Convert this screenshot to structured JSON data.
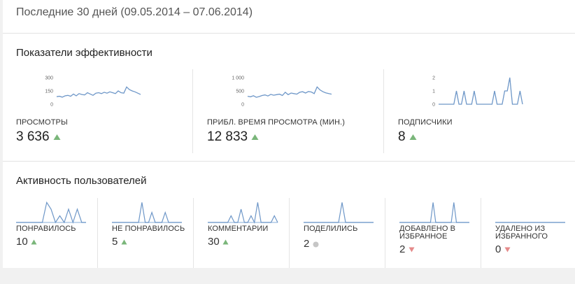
{
  "header": {
    "date_range": "Последние 30 дней (09.05.2014 – 07.06.2014)"
  },
  "performance": {
    "title": "Показатели эффективности",
    "metrics": [
      {
        "label": "ПРОСМОТРЫ",
        "value": "3 636",
        "trend": "up",
        "y_ticks": [
          "300",
          "150",
          "0"
        ],
        "y_max": 300,
        "series": [
          85,
          90,
          80,
          95,
          100,
          90,
          115,
          95,
          120,
          110,
          105,
          130,
          115,
          100,
          125,
          130,
          120,
          135,
          125,
          140,
          130,
          120,
          150,
          130,
          125,
          195,
          165,
          150,
          140,
          125,
          110
        ]
      },
      {
        "label": "ПРИБЛ. ВРЕМЯ ПРОСМОТРА (МИН.)",
        "value": "12 833",
        "trend": "up",
        "y_ticks": [
          "1 000",
          "500",
          "0"
        ],
        "y_max": 1000,
        "series": [
          300,
          280,
          320,
          260,
          290,
          330,
          350,
          310,
          370,
          340,
          360,
          380,
          330,
          450,
          360,
          420,
          400,
          380,
          450,
          470,
          420,
          480,
          460,
          400,
          650,
          540,
          470,
          430,
          400,
          380
        ]
      },
      {
        "label": "ПОДПИСЧИКИ",
        "value": "8",
        "trend": "up",
        "y_ticks": [
          "2",
          "1",
          "0"
        ],
        "y_max": 2,
        "series": [
          0,
          0,
          0,
          0,
          0,
          0,
          0,
          1,
          0,
          0,
          1,
          0,
          0,
          0,
          1,
          0,
          0,
          0,
          0,
          0,
          0,
          0,
          1,
          0,
          0,
          0,
          1,
          1,
          2,
          0,
          0,
          0,
          1,
          0
        ]
      }
    ]
  },
  "activity": {
    "title": "Активность пользователей",
    "metrics": [
      {
        "label": "ПОНРАВИЛОСЬ",
        "value": "10",
        "trend": "up",
        "series": [
          0,
          0,
          0,
          0,
          0,
          0,
          0,
          3,
          2,
          0,
          1,
          0,
          2,
          0,
          2,
          0,
          0
        ]
      },
      {
        "label": "НЕ ПОНРАВИЛОСЬ",
        "value": "5",
        "trend": "up",
        "series": [
          0,
          0,
          0,
          0,
          0,
          0,
          0,
          0,
          0,
          2,
          0,
          0,
          1,
          0,
          0,
          0,
          1,
          0,
          0,
          0,
          0,
          0
        ]
      },
      {
        "label": "КОММЕНТАРИИ",
        "value": "30",
        "trend": "up",
        "series": [
          0,
          0,
          0,
          0,
          0,
          0,
          0,
          1,
          0,
          0,
          2,
          0,
          0,
          1,
          0,
          3,
          0,
          0,
          0,
          0,
          1,
          0
        ]
      },
      {
        "label": "ПОДЕЛИЛИСЬ",
        "value": "2",
        "trend": "flat",
        "series": [
          0,
          0,
          0,
          0,
          0,
          0,
          0,
          0,
          0,
          0,
          0,
          1,
          0,
          0,
          0,
          0,
          0,
          0,
          0,
          0,
          0
        ]
      },
      {
        "label": "ДОБАВЛЕНО В ИЗБРАННОЕ",
        "value": "2",
        "trend": "down",
        "series": [
          0,
          0,
          0,
          0,
          0,
          0,
          0,
          0,
          0,
          0,
          0,
          0,
          0,
          1,
          0,
          0,
          0,
          0,
          0,
          0,
          0,
          1,
          0,
          0,
          0,
          0,
          0,
          0
        ]
      },
      {
        "label": "УДАЛЕНО ИЗ ИЗБРАННОГО",
        "value": "0",
        "trend": "down",
        "series": [
          0,
          0,
          0,
          0,
          0,
          0,
          0,
          0,
          0,
          0,
          0,
          0,
          0,
          0,
          0,
          0,
          0,
          0,
          0,
          0
        ]
      }
    ]
  },
  "colors": {
    "line": "#6e97c8",
    "baseline": "#9fbde0",
    "trend_up": "#7ab67a",
    "trend_down": "#e58a8a",
    "trend_flat": "#c6c6c6"
  }
}
